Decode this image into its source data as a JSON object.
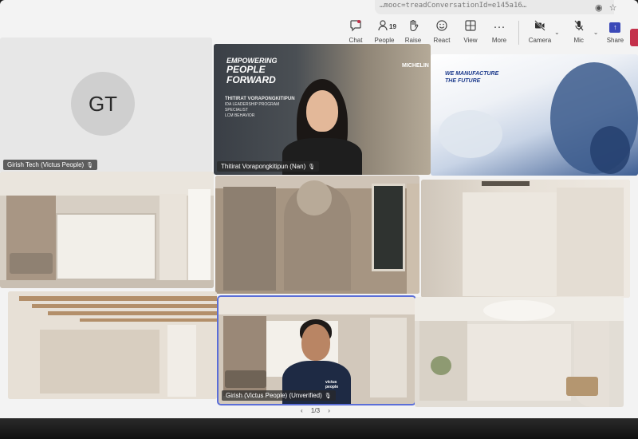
{
  "browser": {
    "address": "…mooc=treadConversationId=e145a16…"
  },
  "toolbar": {
    "chat_label": "Chat",
    "people_label": "People",
    "people_count": "19",
    "raise_label": "Raise",
    "react_label": "React",
    "view_label": "View",
    "more_label": "More",
    "camera_label": "Camera",
    "mic_label": "Mic",
    "share_label": "Share"
  },
  "tiles": {
    "gt": {
      "initials": "GT",
      "name": "Girish Tech (Victus People)"
    },
    "presenter": {
      "name": "Thitirat Vorapongkitipun (Nan)",
      "bg_line1": "EMPOWERING",
      "bg_line2": "PEOPLE",
      "bg_line3": "FORWARD",
      "bg_sub_name": "THITIRAT VORAPONGKITIPUN",
      "bg_sub_role1": "IDA LEADERSHIP PROGRAM SPECIALIST",
      "bg_sub_role2": "LCM BEHAVIOR",
      "bg_logo": "MICHELIN"
    },
    "brand_tile": {
      "line1": "WE MANUFACTURE",
      "line2": "THE FUTURE"
    },
    "girish": {
      "name": "Girish (Victus People) (Unverified)",
      "shirt_text": "victus people"
    }
  },
  "pager": {
    "prev": "‹",
    "label": "1/3",
    "next": "›"
  },
  "colors": {
    "active_outline": "#5b6ed8",
    "share_blue": "#3b49b8",
    "leave_red": "#c4314b"
  }
}
